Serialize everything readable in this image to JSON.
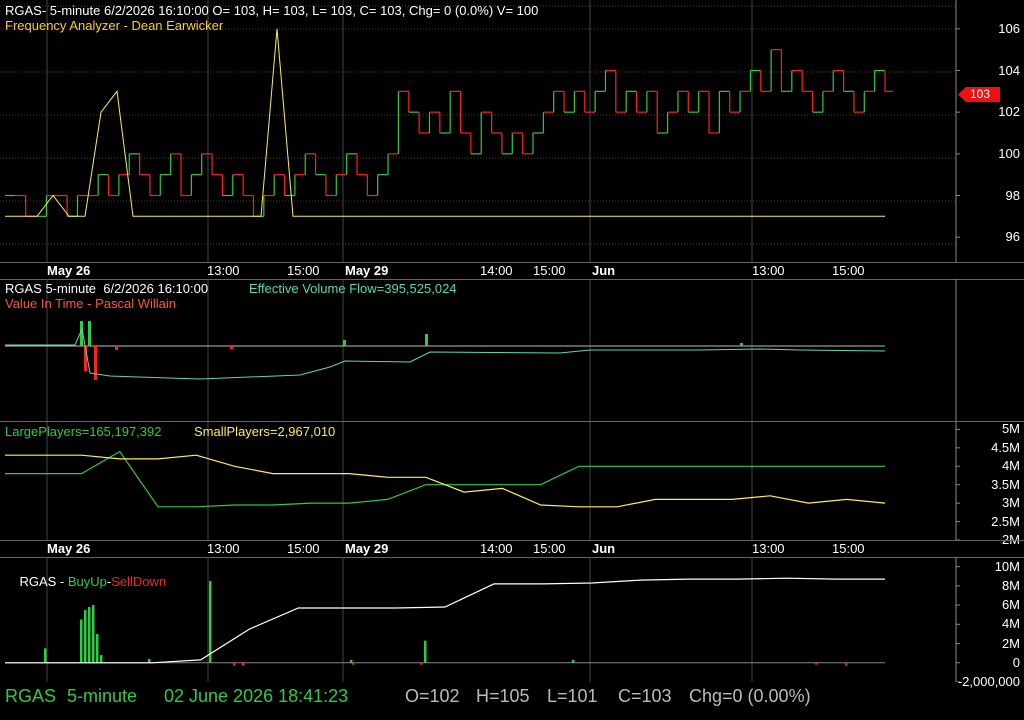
{
  "colors": {
    "up": "#2ecc40",
    "down": "#ff2020",
    "yellow": "#ffee55",
    "cyan": "#55ddaa",
    "white": "#ffffff",
    "grid": "#444444",
    "price_tag": "#ee1111"
  },
  "panel1": {
    "header": "RGAS- 5-minute 6/2/2026 16:10:00 O= 103, H= 103, L= 103, C= 103, Chg= 0 (0.0%) V= 100",
    "subheader": "Frequency Analyzer - Dean Earwicker",
    "yticks": [
      "106",
      "104",
      "102",
      "100",
      "98",
      "96"
    ],
    "price_tag": "103"
  },
  "panel2": {
    "header_left": "RGAS 5-minute  6/2/2026 16:10:00",
    "header_right": "Effective Volume Flow=395,525,024",
    "subheader": "Value In Time - Pascal Willain"
  },
  "panel3": {
    "large_label": "LargePlayers=165,197,392",
    "small_label": "SmallPlayers=2,967,010",
    "yticks": [
      "5M",
      "4.5M",
      "4M",
      "3.5M",
      "3M",
      "2.5M",
      "2M"
    ]
  },
  "panel4": {
    "header_prefix": "RGAS - ",
    "buy_label": "BuyUp",
    "dash": "-",
    "sell_label": "SellDown",
    "yticks": [
      "10M",
      "8M",
      "6M",
      "4M",
      "2M",
      "0",
      "-2,000,000"
    ]
  },
  "date_axis": [
    {
      "label": "May 26",
      "bold": true
    },
    {
      "label": "13:00",
      "bold": false
    },
    {
      "label": "15:00",
      "bold": false
    },
    {
      "label": "May 29",
      "bold": true
    },
    {
      "label": "14:00",
      "bold": false
    },
    {
      "label": "15:00",
      "bold": false
    },
    {
      "label": "Jun",
      "bold": true
    },
    {
      "label": "13:00",
      "bold": false
    },
    {
      "label": "15:00",
      "bold": false
    }
  ],
  "status": {
    "symbol": "RGAS",
    "interval": "5-minute",
    "datetime": "02 June 2026 18:41:23",
    "open": "O=102",
    "high": "H=105",
    "low": "L=101",
    "close": "C=103",
    "change": "Chg=0 (0.00%)"
  },
  "chart_data": [
    {
      "type": "line",
      "title": "RGAS- 5-minute",
      "ylim": [
        95,
        107
      ],
      "series": [
        {
          "name": "",
          "values": [
            98,
            98,
            97,
            97,
            98,
            98,
            97,
            98,
            98,
            99,
            98,
            99,
            100,
            99,
            98,
            99,
            100,
            98,
            99,
            100,
            99,
            98,
            99,
            98,
            97,
            98,
            99,
            98,
            99,
            100,
            99,
            98,
            99,
            100,
            99,
            98,
            99,
            100,
            103,
            102,
            101,
            102,
            101,
            103,
            101,
            100,
            102,
            101,
            100,
            101,
            100,
            101,
            102,
            103,
            102,
            103,
            102,
            103,
            104,
            102,
            103,
            102,
            103,
            101,
            102,
            103,
            102,
            103,
            101,
            103,
            102,
            103,
            104,
            103,
            105,
            103,
            104,
            103,
            102,
            103,
            104,
            103,
            102,
            103,
            104,
            103
          ]
        }
      ]
    },
    {
      "type": "line",
      "title": "Frequency Analyzer - Dean Earwicker",
      "ylim": [
        95,
        107
      ],
      "series": [
        {
          "name": "",
          "values": [
            97,
            97,
            97,
            98,
            97,
            97,
            102,
            103,
            97,
            97,
            97,
            97,
            97,
            97,
            97,
            97,
            97,
            106,
            97,
            97,
            97,
            97,
            97,
            97,
            97,
            97,
            97,
            97,
            97,
            97,
            97,
            97,
            97,
            97,
            97,
            97,
            97,
            97,
            97,
            97,
            97,
            97,
            97,
            97,
            97,
            97,
            97,
            97,
            97,
            97,
            97,
            97,
            97,
            97,
            97,
            97
          ]
        }
      ]
    },
    {
      "type": "line",
      "title": "LargePlayers / SmallPlayers",
      "ylim": [
        2000000,
        5200000
      ],
      "series": [
        {
          "name": "LargePlayers",
          "values": [
            3800000,
            3800000,
            3800000,
            4400000,
            2900000,
            2900000,
            2950000,
            2950000,
            3000000,
            3000000,
            3100000,
            3500000,
            3500000,
            3500000,
            3500000,
            4000000,
            4000000,
            4000000,
            4000000,
            4000000,
            4000000,
            4000000,
            4000000,
            4000000
          ]
        },
        {
          "name": "SmallPlayers",
          "values": [
            4300000,
            4300000,
            4300000,
            4200000,
            4200000,
            4300000,
            4000000,
            3800000,
            3800000,
            3800000,
            3700000,
            3700000,
            3300000,
            3400000,
            2950000,
            2900000,
            2900000,
            3100000,
            3100000,
            3100000,
            3200000,
            3000000,
            3100000,
            3000000
          ]
        }
      ]
    },
    {
      "type": "area",
      "title": "RGAS - BuyUp-SellDown",
      "ylim": [
        -2000000,
        11000000
      ],
      "series": [
        {
          "name": "BuyUp-SellDown",
          "values": [
            0,
            0,
            0,
            0,
            300000,
            3500000,
            5700000,
            5700000,
            5700000,
            5800000,
            8200000,
            8200000,
            8300000,
            8600000,
            8700000,
            8700000,
            8800000,
            8700000,
            8700000
          ]
        }
      ]
    }
  ]
}
